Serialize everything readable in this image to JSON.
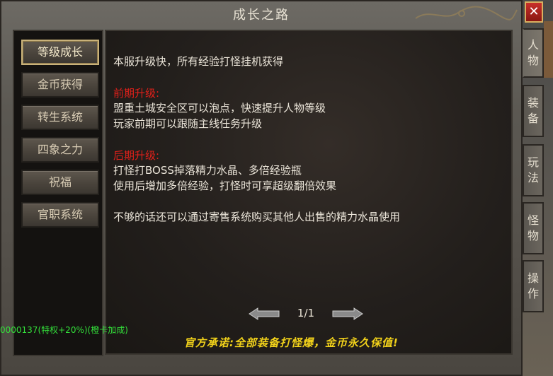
{
  "window": {
    "title": "成长之路",
    "close_label": "✕"
  },
  "left_menu": [
    {
      "label": "等级成长",
      "active": true
    },
    {
      "label": "金币获得",
      "active": false
    },
    {
      "label": "转生系统",
      "active": false
    },
    {
      "label": "四象之力",
      "active": false
    },
    {
      "label": "祝福",
      "active": false
    },
    {
      "label": "官职系统",
      "active": false
    }
  ],
  "content": {
    "intro": "本服升级快，所有经验打怪挂机获得",
    "early_heading": "前期升级:",
    "early_line1": "盟重土城安全区可以泡点，快速提升人物等级",
    "early_line2": "玩家前期可以跟随主线任务升级",
    "late_heading": "后期升级:",
    "late_line1": "打怪打BOSS掉落精力水晶、多倍经验瓶",
    "late_line2": "使用后增加多倍经验，打怪时可享超级翻倍效果",
    "note": "不够的话还可以通过寄售系统购买其他人出售的精力水晶使用"
  },
  "pager": {
    "current": "1/1"
  },
  "promise": "官方承诺:全部装备打怪爆，金币永久保值!",
  "side_tabs": [
    {
      "chars": [
        "人",
        "物"
      ],
      "active": true
    },
    {
      "chars": [
        "装",
        "备"
      ],
      "active": false
    },
    {
      "chars": [
        "玩",
        "法"
      ],
      "active": false
    },
    {
      "chars": [
        "怪",
        "物"
      ],
      "active": false
    },
    {
      "chars": [
        "操",
        "作"
      ],
      "active": false
    }
  ],
  "status_text": "0000137(特权+20%)(橙卡加成)",
  "colors": {
    "heading_red": "#e0201a",
    "promise_yellow": "#f2d21a",
    "status_green": "#33e03a"
  }
}
